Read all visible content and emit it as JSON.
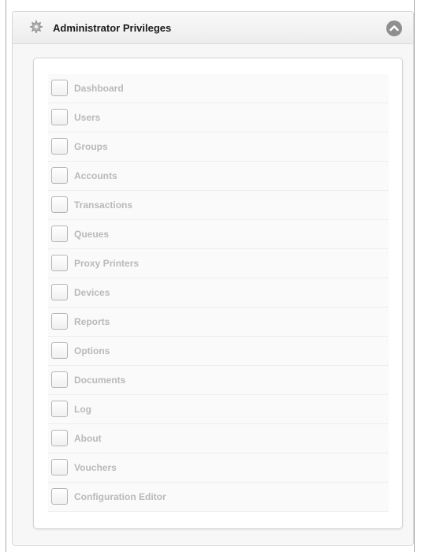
{
  "panel": {
    "title": "Administrator Privileges",
    "header_icon": "gear-icon",
    "collapse_icon": "chevron-up-icon"
  },
  "privileges": [
    {
      "label": "Dashboard",
      "checked": false
    },
    {
      "label": "Users",
      "checked": false
    },
    {
      "label": "Groups",
      "checked": false
    },
    {
      "label": "Accounts",
      "checked": false
    },
    {
      "label": "Transactions",
      "checked": false
    },
    {
      "label": "Queues",
      "checked": false
    },
    {
      "label": "Proxy Printers",
      "checked": false
    },
    {
      "label": "Devices",
      "checked": false
    },
    {
      "label": "Reports",
      "checked": false
    },
    {
      "label": "Options",
      "checked": false
    },
    {
      "label": "Documents",
      "checked": false
    },
    {
      "label": "Log",
      "checked": false
    },
    {
      "label": "About",
      "checked": false
    },
    {
      "label": "Vouchers",
      "checked": false
    },
    {
      "label": "Configuration Editor",
      "checked": false
    }
  ],
  "colors": {
    "label_disabled": "#b9b9b9",
    "collapse_button": "#8f8f8f"
  }
}
